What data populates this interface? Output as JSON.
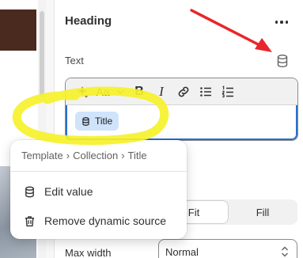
{
  "panel": {
    "title": "Heading",
    "field_label": "Text",
    "chip_label": "Title",
    "toolbar_aa": "Aa",
    "toolbar_bold": "B",
    "toolbar_italic": "I"
  },
  "popover": {
    "breadcrumb": [
      "Template",
      "Collection",
      "Title"
    ],
    "separator": "›",
    "edit_label": "Edit value",
    "remove_label": "Remove dynamic source"
  },
  "image_fit": {
    "options": [
      "Fit",
      "Fill"
    ],
    "selected": "Fit"
  },
  "max_width": {
    "label": "Max width",
    "value": "Normal"
  },
  "icons": [
    "more-horizontal-icon",
    "database-icon",
    "magic-icon",
    "chevron-down-icon",
    "link-icon",
    "bullet-list-icon",
    "numbered-list-icon",
    "trash-icon",
    "select-caret-icon"
  ],
  "colors": {
    "accent": "#2c6ecb",
    "chip": "#cfe3fb",
    "annotation_arrow": "#e8262b",
    "annotation_highlight": "#f6f12a"
  }
}
